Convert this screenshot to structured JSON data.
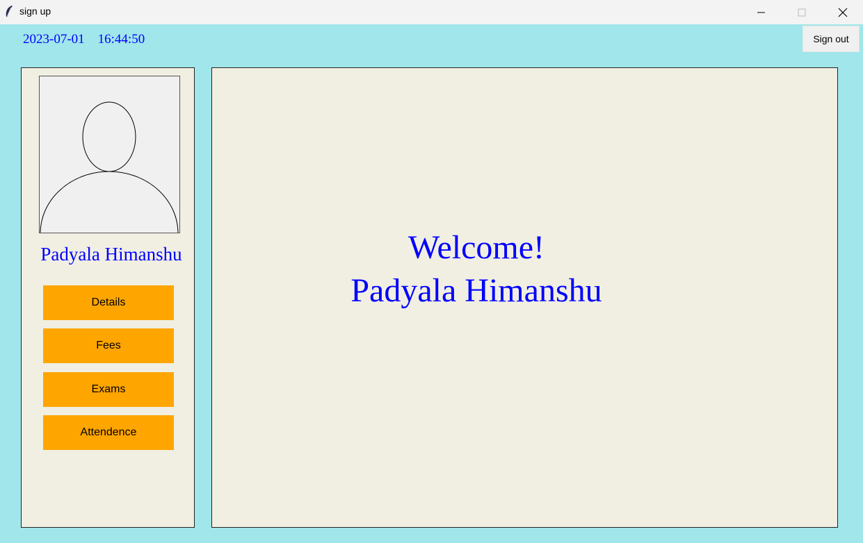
{
  "window": {
    "title": "sign up",
    "app_icon": "feather-icon",
    "controls": [
      "minimize-icon",
      "maximize-icon",
      "close-icon"
    ]
  },
  "header": {
    "date": "2023-07-01",
    "time": "16:44:50",
    "sign_out_label": "Sign out"
  },
  "sidebar": {
    "avatar_icon": "user-avatar-icon",
    "user_name": "Padyala Himanshu",
    "buttons": [
      {
        "label": "Details"
      },
      {
        "label": "Fees"
      },
      {
        "label": "Exams"
      },
      {
        "label": "Attendence"
      }
    ]
  },
  "main": {
    "welcome_line": "Welcome!",
    "user_name": "Padyala Himanshu"
  },
  "colors": {
    "background": "#a0e6ea",
    "panel": "#f1efe2",
    "accent_text": "#0000ff",
    "button": "#ffa500"
  }
}
